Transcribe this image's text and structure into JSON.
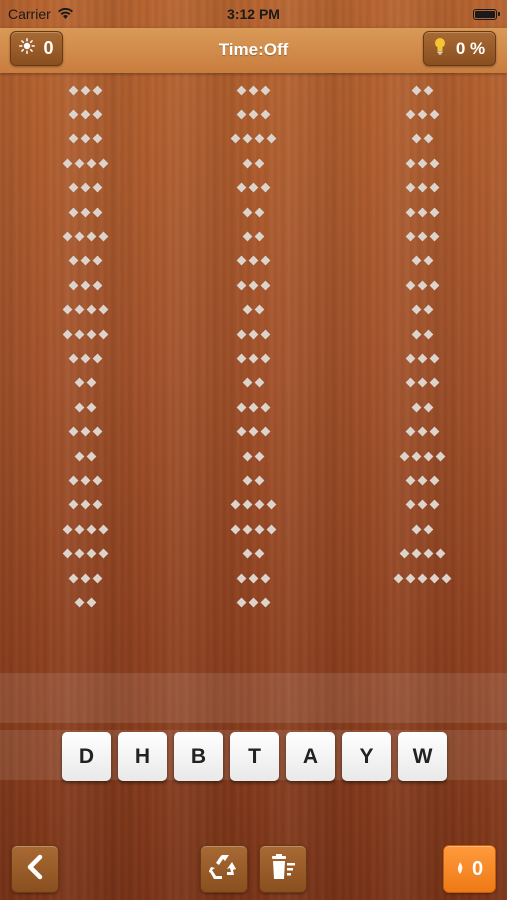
{
  "status_bar": {
    "carrier": "Carrier",
    "time": "3:12 PM"
  },
  "toolbar": {
    "sun_count": "0",
    "title": "Time:Off",
    "hint_percent": "0 %"
  },
  "grid_columns": [
    [
      3,
      3,
      3,
      4,
      3,
      3,
      4,
      3,
      3,
      4,
      4,
      3,
      2,
      2,
      3,
      2,
      3,
      3,
      4,
      4,
      3,
      2
    ],
    [
      3,
      3,
      4,
      2,
      3,
      2,
      2,
      3,
      3,
      2,
      3,
      3,
      2,
      3,
      3,
      2,
      2,
      4,
      4,
      2,
      3,
      3
    ],
    [
      2,
      3,
      2,
      3,
      3,
      3,
      3,
      2,
      3,
      2,
      2,
      3,
      3,
      2,
      3,
      4,
      3,
      3,
      2,
      4,
      5
    ]
  ],
  "letters": [
    "D",
    "H",
    "B",
    "T",
    "A",
    "Y",
    "W"
  ],
  "bottom_bar": {
    "coin_count": "0"
  },
  "colors": {
    "accent_orange": "#ee7a16",
    "wood": "#a4522a",
    "topbar": "#d99a57"
  }
}
